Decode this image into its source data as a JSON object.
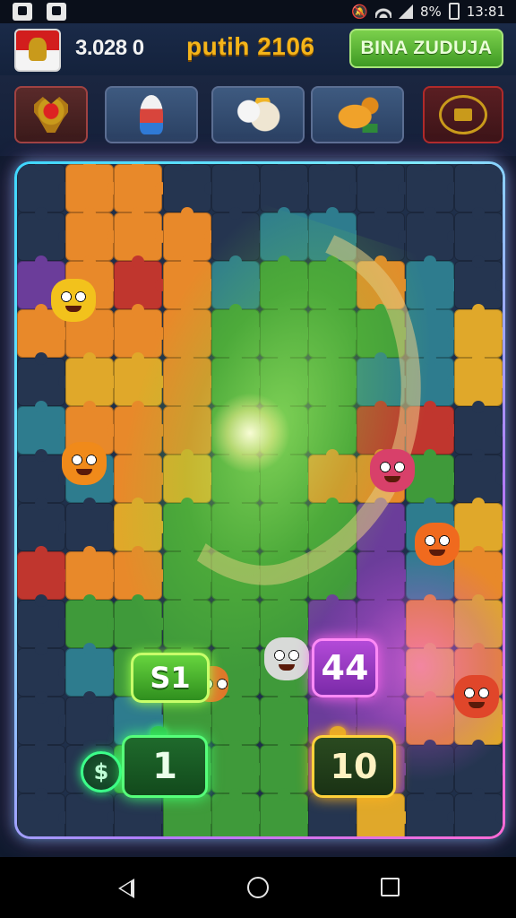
{
  "status_bar": {
    "battery_text": "8%",
    "time": "13:81"
  },
  "header": {
    "score": "3.028 0",
    "title": "putih 2106",
    "action_button": "BINA ZUDUJA"
  },
  "categories": [
    {
      "name": "emblem",
      "icon": "eagle-crest-icon"
    },
    {
      "name": "rocket",
      "icon": "rocket-icon"
    },
    {
      "name": "animals",
      "icon": "animal-icon"
    },
    {
      "name": "bird",
      "icon": "bird-icon"
    },
    {
      "name": "laurel",
      "icon": "laurel-crest-icon"
    }
  ],
  "board": {
    "badges": {
      "s1": "S1",
      "purple": "44",
      "green_bag": "1",
      "yellow_bag": "10",
      "coin_symbol": "$"
    }
  },
  "colors": {
    "accent_title": "#f4b41a",
    "button_green": "#4fb02e",
    "board_border_start": "#3fd6ff",
    "board_border_end": "#ff6ad5",
    "piece_orange": "#e8892a",
    "piece_green": "#3f9a3a",
    "piece_teal": "#2e7c8e",
    "piece_red": "#c0362e",
    "piece_purple": "#6b3d9a",
    "piece_yellow": "#e0a82a",
    "piece_dark": "#253550"
  }
}
